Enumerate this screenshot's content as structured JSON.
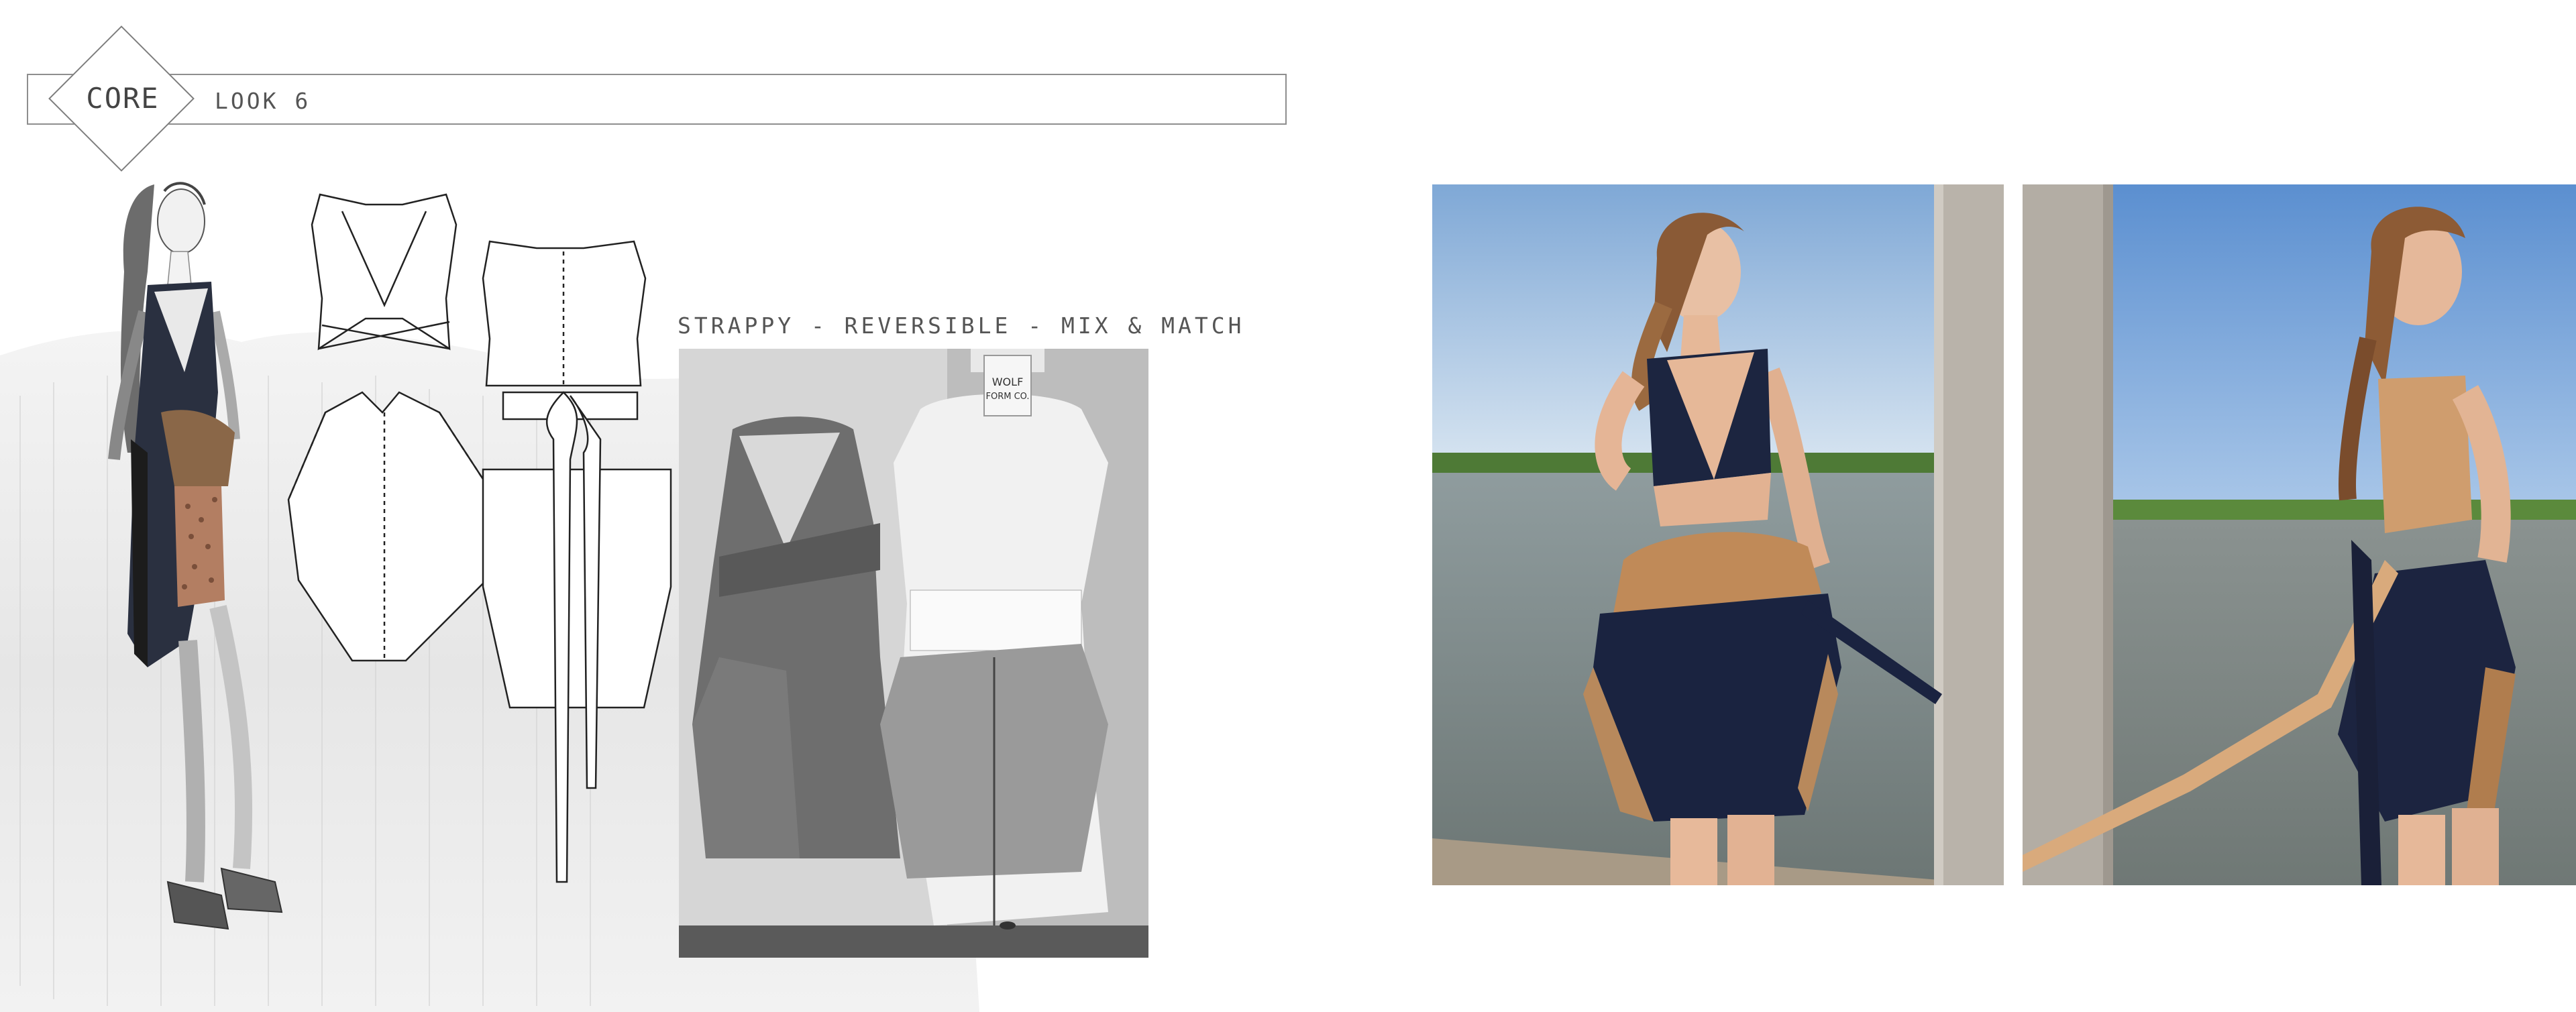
{
  "header": {
    "section": "CORE",
    "look": "LOOK 6"
  },
  "tagline": "STRAPPY - REVERSIBLE - MIX & MATCH",
  "mannequin_tags": {
    "tag_left": "WOLF",
    "tag_right": "FORM CO."
  },
  "colors": {
    "navy": "#1f2a44",
    "cork": "#c99a6a",
    "sky": "#8fb4dc",
    "water": "#7d8a8a",
    "concrete": "#b9b4ad"
  }
}
